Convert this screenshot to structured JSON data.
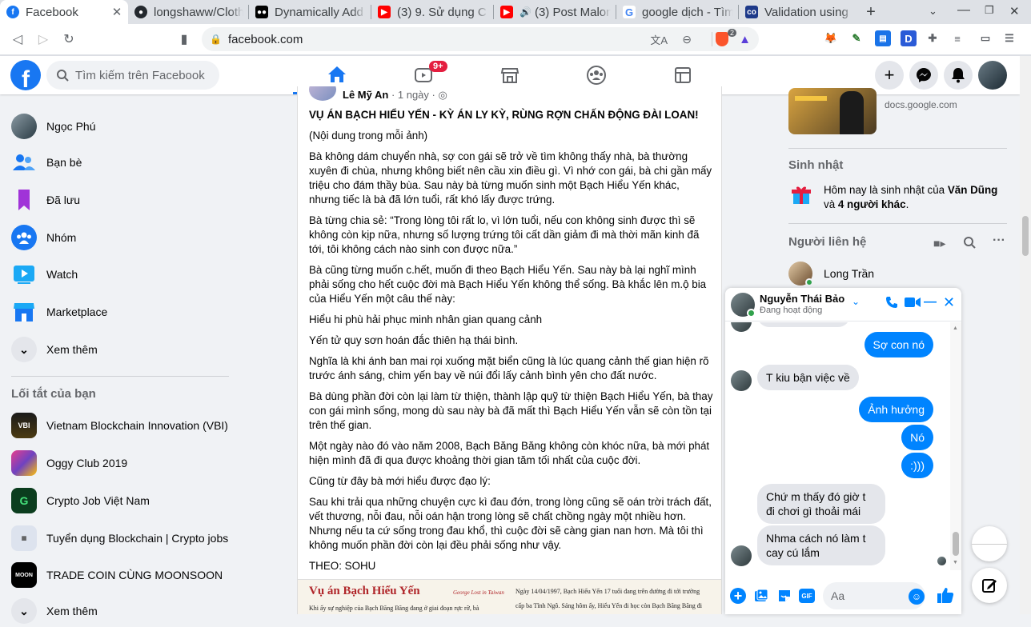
{
  "browser": {
    "tabs": [
      {
        "title": "Facebook",
        "favicon": "facebook-icon",
        "active": true
      },
      {
        "title": "longshaww/Cloth",
        "favicon": "github-icon"
      },
      {
        "title": "Dynamically Add",
        "favicon": "medium-icon"
      },
      {
        "title": "(3) 9. Sử dụng C",
        "favicon": "youtube-icon"
      },
      {
        "title": "(3) Post Malon",
        "favicon": "youtube-icon"
      },
      {
        "title": "google dịch - Tìm",
        "favicon": "google-icon"
      },
      {
        "title": "Validation using",
        "favicon": "codepen-icon"
      }
    ],
    "url": "facebook.com",
    "brave_badge": "2"
  },
  "fb": {
    "search_placeholder": "Tìm kiếm trên Facebook",
    "watch_badge": "9+",
    "accent": "#1877f2"
  },
  "leftnav": {
    "items": [
      {
        "label": "Ngọc Phú",
        "icon": "profile-avatar"
      },
      {
        "label": "Bạn bè",
        "icon": "friends-icon"
      },
      {
        "label": "Đã lưu",
        "icon": "saved-icon"
      },
      {
        "label": "Nhóm",
        "icon": "groups-icon"
      },
      {
        "label": "Watch",
        "icon": "watch-icon"
      },
      {
        "label": "Marketplace",
        "icon": "marketplace-icon"
      },
      {
        "label": "Xem thêm",
        "icon": "chevron-down-icon"
      }
    ],
    "shortcuts_title": "Lối tắt của bạn",
    "shortcuts": [
      {
        "label": "Vietnam Blockchain Innovation (VBI)"
      },
      {
        "label": "Oggy Club 2019"
      },
      {
        "label": "Crypto Job Việt Nam"
      },
      {
        "label": "Tuyển dụng Blockchain | Crypto jobs"
      },
      {
        "label": "TRADE COIN CÙNG MOONSOON"
      },
      {
        "label": "Xem thêm"
      }
    ]
  },
  "post": {
    "author": "Lê Mỹ An",
    "time": "· 1 ngày ·",
    "title": "VỤ ÁN BẠCH HIỂU YẾN - KỲ ÁN LY KỲ, RÙNG RỢN CHẤN ĐỘNG ĐÀI LOAN!",
    "paragraphs": [
      "(Nội dung trong mỗi ảnh)",
      "Bà không dám chuyển nhà, sợ con gái sẽ trở về tìm không thấy nhà, bà thường xuyên đi chùa, nhưng không biết nên cầu xin điều gì. Vì nhớ con gái, bà chi gần mấy triệu cho đám thầy bùa. Sau này bà từng muốn sinh một Bạch Hiểu Yến khác, nhưng tiếc là bà đã lớn tuổi, rất khó lấy được trứng.",
      "Bà từng chia sẻ: “Trong lòng tôi rất lo, vì lớn tuổi, nếu con không sinh được thì sẽ không còn kịp nữa, nhưng số lượng trứng tôi cất dần giảm đi mà thời mãn kinh đã tới, tôi không cách nào sinh con được nữa.”",
      "Bà cũng từng muốn c.hết, muốn đi theo Bạch Hiểu Yến. Sau này bà lại nghĩ mình phải sống cho hết cuộc đời mà Bạch Hiểu Yến không thể sống. Bà khắc lên m.ộ bia của Hiểu Yến một câu thế này:",
      "Hiểu hi phù hải phục minh nhân gian quang cảnh",
      "Yến tử quy sơn hoán đắc thiên hạ thái bình.",
      "Nghĩa là khi ánh ban mai rọi xuống mặt biển cũng là lúc quang cảnh thế gian hiện rõ trước ánh sáng, chim yến bay về núi đổi lấy cảnh bình yên cho đất nước.",
      "Bà dùng phần đời còn lại làm từ thiện, thành lập quỹ từ thiện Bạch Hiểu Yến, bà thay con gái mình sống, mong dù sau này bà đã mất thì Bạch Hiểu Yến vẫn sẽ còn tồn tại trên thế gian.",
      "Một ngày nào đó vào năm 2008, Bạch Băng Băng không còn khóc nữa, bà mới phát hiện mình đã đi qua được khoảng thời gian tăm tối nhất của cuộc đời.",
      "Cũng từ đây bà mới hiểu được đạo lý:",
      "Sau khi trải qua những chuyện cực kì đau đớn, trong lòng cũng sẽ oán trời trách đất, vết thương, nỗi đau, nỗi oán hận trong lòng sẽ chất chồng ngày một nhiều hơn. Nhưng nếu ta cứ sống trong đau khổ, thì cuộc đời sẽ càng gian nan hơn. Mà tôi thì không muốn phần đời còn lại đều phải sống như vậy.",
      "THEO: SOHU"
    ],
    "image": {
      "headline": "Vụ án Bạch Hiểu Yến",
      "sub": "George Lost in Taiwan",
      "line1": "Khi ấy sự nghiệp của Bạch Băng Băng đang ở giai đoạn rực rỡ, bà",
      "col1": "Ngày 14/04/1997, Bạch Hiểu Yến 17 tuổi đang trên đường đi tới trường",
      "col2": "cấp ba Tĩnh Ngô. Sáng hôm ấy, Hiểu Yến đi học còn Bạch Băng Băng đi"
    }
  },
  "right": {
    "ad_domain": "docs.google.com",
    "birthday_title": "Sinh nhật",
    "birthday_pre": "Hôm nay là sinh nhật của ",
    "birthday_name": "Văn Dũng",
    "birthday_mid": " và ",
    "birthday_others": "4 người khác",
    "birthday_end": ".",
    "contacts_title": "Người liên hệ",
    "contacts": [
      {
        "name": "Long Trần"
      }
    ]
  },
  "chat": {
    "name": "Nguyễn Thái Bảo",
    "status": "Đang hoạt động",
    "input_placeholder": "Aa",
    "messages": [
      {
        "dir": "out",
        "text": "Sợ con nó"
      },
      {
        "dir": "in",
        "text": "T kiu bận việc về"
      },
      {
        "dir": "out",
        "text": "Ảnh hưởng"
      },
      {
        "dir": "out",
        "text": "Nó"
      },
      {
        "dir": "out",
        "text": ":)))"
      },
      {
        "dir": "in",
        "text": "Chứ m thấy đó giờ t đi chơi gì thoải mái"
      },
      {
        "dir": "in",
        "text": "Nhma cách nó làm t cay cú lắm"
      }
    ]
  }
}
